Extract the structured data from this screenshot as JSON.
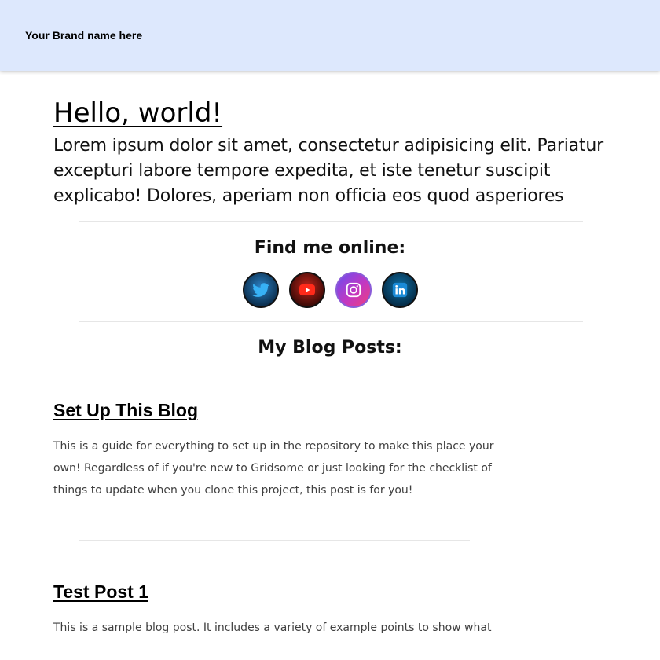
{
  "navbar": {
    "brand": "Your Brand name here"
  },
  "hero": {
    "title": "Hello, world!",
    "text": "Lorem ipsum dolor sit amet, consectetur adipisicing elit. Pariatur excepturi labore tempore expedita, et iste tenetur suscipit explicabo! Dolores, aperiam non officia eos quod asperiores"
  },
  "social": {
    "heading": "Find me online:",
    "links": [
      {
        "icon": "twitter-icon"
      },
      {
        "icon": "youtube-icon"
      },
      {
        "icon": "instagram-icon"
      },
      {
        "icon": "linkedin-icon"
      }
    ]
  },
  "blog": {
    "heading": "My Blog Posts:",
    "posts": [
      {
        "title": "Set Up This Blog",
        "excerpt": "This is a guide for everything to set up in the repository to make this place your own! Regardless of if you're new to Gridsome or just looking for the checklist of things to update when you clone this project, this post is for you!"
      },
      {
        "title": "Test Post 1",
        "excerpt": "This is a sample blog post. It includes a variety of example points to show what"
      }
    ]
  },
  "colors": {
    "navbar_bg": "#dde8fd",
    "twitter": "#1d9bf0",
    "youtube": "#ff0000",
    "instagram": "#c13584",
    "linkedin": "#0a66c2"
  }
}
